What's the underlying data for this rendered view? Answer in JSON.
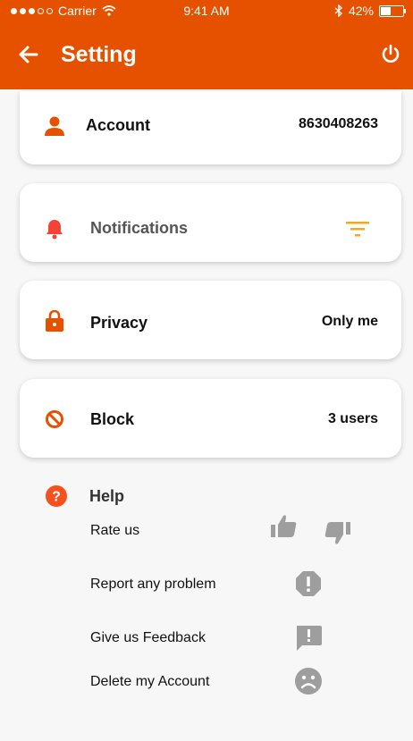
{
  "status_bar": {
    "carrier": "Carrier",
    "time": "9:41 AM",
    "battery": "42%",
    "battery_level": 0.42
  },
  "header": {
    "title": "Setting"
  },
  "cards": {
    "account": {
      "label": "Account",
      "value": "8630408263"
    },
    "notifications": {
      "label": "Notifications"
    },
    "privacy": {
      "label": "Privacy",
      "value": "Only me"
    },
    "block": {
      "label": "Block",
      "value": "3 users"
    }
  },
  "help": {
    "title": "Help",
    "items": [
      {
        "label": "Rate us"
      },
      {
        "label": "Report any problem"
      },
      {
        "label": "Give us Feedback"
      },
      {
        "label": "Delete my Account"
      }
    ]
  },
  "colors": {
    "accent": "#e65100",
    "bell": "#f44336",
    "filter": "#f5a623",
    "grey_icon": "#9e9e9e"
  },
  "icons": [
    "back-arrow-icon",
    "power-icon",
    "person-icon",
    "bell-icon",
    "filter-icon",
    "lock-icon",
    "block-icon",
    "help-icon",
    "thumbs-up-icon",
    "thumbs-down-icon",
    "report-icon",
    "feedback-icon",
    "sad-face-icon"
  ]
}
